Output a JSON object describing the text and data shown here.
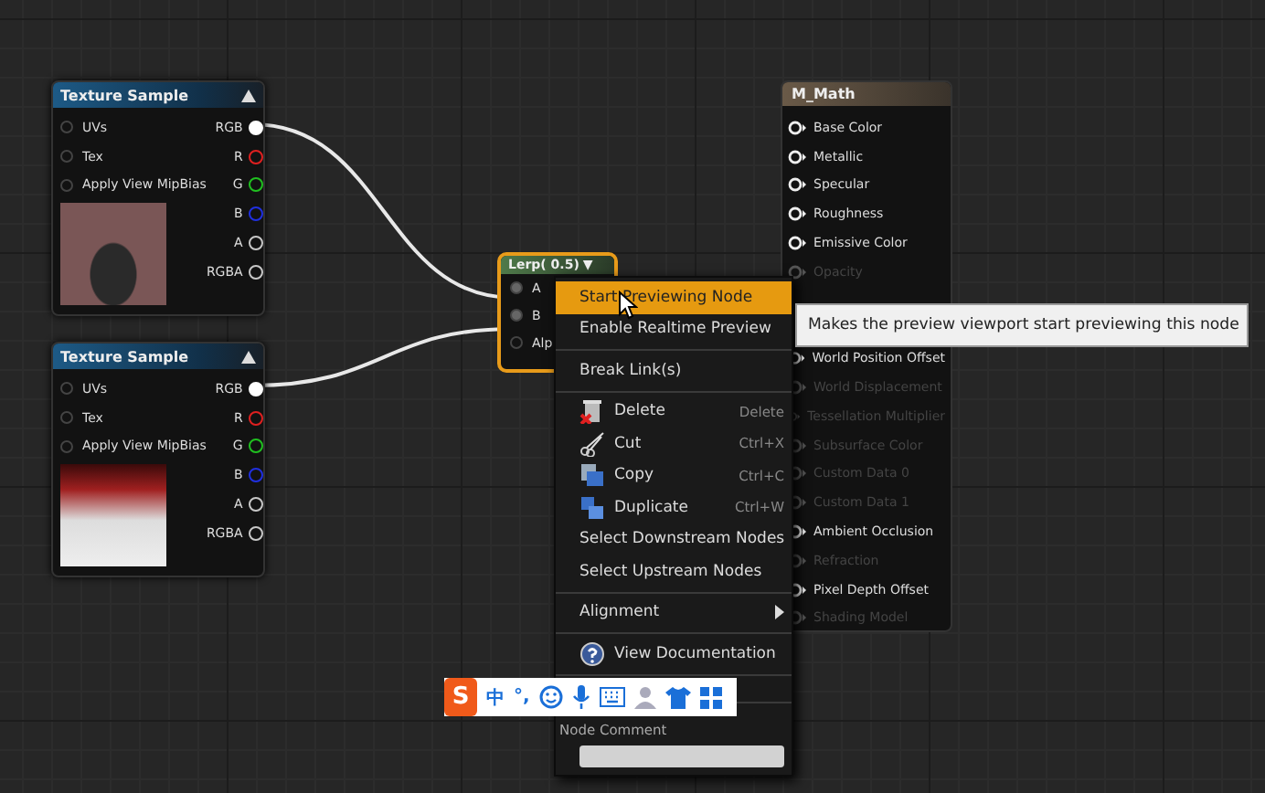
{
  "texture_nodes": [
    {
      "title": "Texture Sample",
      "inputs": [
        "UVs",
        "Tex",
        "Apply View MipBias"
      ],
      "outputs": [
        {
          "label": "RGB",
          "color": "#ffffff",
          "connected": true
        },
        {
          "label": "R",
          "color": "#e02020",
          "connected": false
        },
        {
          "label": "G",
          "color": "#20c020",
          "connected": false
        },
        {
          "label": "B",
          "color": "#2030e0",
          "connected": false
        },
        {
          "label": "A",
          "color": "#c8c8c8",
          "connected": false
        },
        {
          "label": "RGBA",
          "color": "#c8c8c8",
          "connected": false
        }
      ]
    },
    {
      "title": "Texture Sample",
      "inputs": [
        "UVs",
        "Tex",
        "Apply View MipBias"
      ],
      "outputs": [
        {
          "label": "RGB",
          "color": "#ffffff",
          "connected": true
        },
        {
          "label": "R",
          "color": "#e02020",
          "connected": false
        },
        {
          "label": "G",
          "color": "#20c020",
          "connected": false
        },
        {
          "label": "B",
          "color": "#2030e0",
          "connected": false
        },
        {
          "label": "A",
          "color": "#c8c8c8",
          "connected": false
        },
        {
          "label": "RGBA",
          "color": "#c8c8c8",
          "connected": false
        }
      ]
    }
  ],
  "lerp_node": {
    "title": "Lerp( 0.5)",
    "collapse": "▼",
    "inputs": [
      {
        "label": "A",
        "connected": true
      },
      {
        "label": "B",
        "connected": true
      },
      {
        "label": "Alp",
        "connected": false
      }
    ]
  },
  "material_node": {
    "title": "M_Math",
    "pins": [
      {
        "label": "Base Color",
        "disabled": false
      },
      {
        "label": "Metallic",
        "disabled": false
      },
      {
        "label": "Specular",
        "disabled": false
      },
      {
        "label": "Roughness",
        "disabled": false
      },
      {
        "label": "Emissive Color",
        "disabled": false
      },
      {
        "label": "Opacity",
        "disabled": true
      }
    ],
    "lower_pins": [
      {
        "label": "World Position Offset",
        "disabled": false
      },
      {
        "label": "World Displacement",
        "disabled": true
      },
      {
        "label": "Tessellation Multiplier",
        "disabled": true
      },
      {
        "label": "Subsurface Color",
        "disabled": true
      },
      {
        "label": "Custom Data 0",
        "disabled": true
      },
      {
        "label": "Custom Data 1",
        "disabled": true
      },
      {
        "label": "Ambient Occlusion",
        "disabled": false
      },
      {
        "label": "Refraction",
        "disabled": true
      },
      {
        "label": "Pixel Depth Offset",
        "disabled": false
      },
      {
        "label": "Shading Model",
        "disabled": true
      }
    ]
  },
  "context_menu": {
    "sections": [
      [
        {
          "label": "Start Previewing Node",
          "kind": "plain",
          "selected": true
        },
        {
          "label": "Enable Realtime Preview",
          "kind": "plain",
          "selected": false
        }
      ],
      [
        {
          "label": "Break Link(s)",
          "kind": "plain",
          "selected": false
        }
      ],
      [
        {
          "label": "Delete",
          "shortcut": "Delete",
          "kind": "delete",
          "selected": false
        },
        {
          "label": "Cut",
          "shortcut": "Ctrl+X",
          "kind": "cut",
          "selected": false
        },
        {
          "label": "Copy",
          "shortcut": "Ctrl+C",
          "kind": "copy",
          "selected": false
        },
        {
          "label": "Duplicate",
          "shortcut": "Ctrl+W",
          "kind": "duplicate",
          "selected": false
        },
        {
          "label": "Select Downstream Nodes",
          "kind": "plain",
          "selected": false
        },
        {
          "label": "Select Upstream Nodes",
          "kind": "plain",
          "selected": false
        }
      ],
      [
        {
          "label": "Alignment",
          "kind": "submenu",
          "selected": false
        }
      ],
      [
        {
          "label": "View Documentation",
          "kind": "help",
          "selected": false
        }
      ]
    ],
    "comment_label": "Node Comment"
  },
  "tooltip": "Makes the preview viewport start previewing this node",
  "ime_toolbar": {
    "logo": "S",
    "language": "中",
    "punctuation": "°,"
  }
}
